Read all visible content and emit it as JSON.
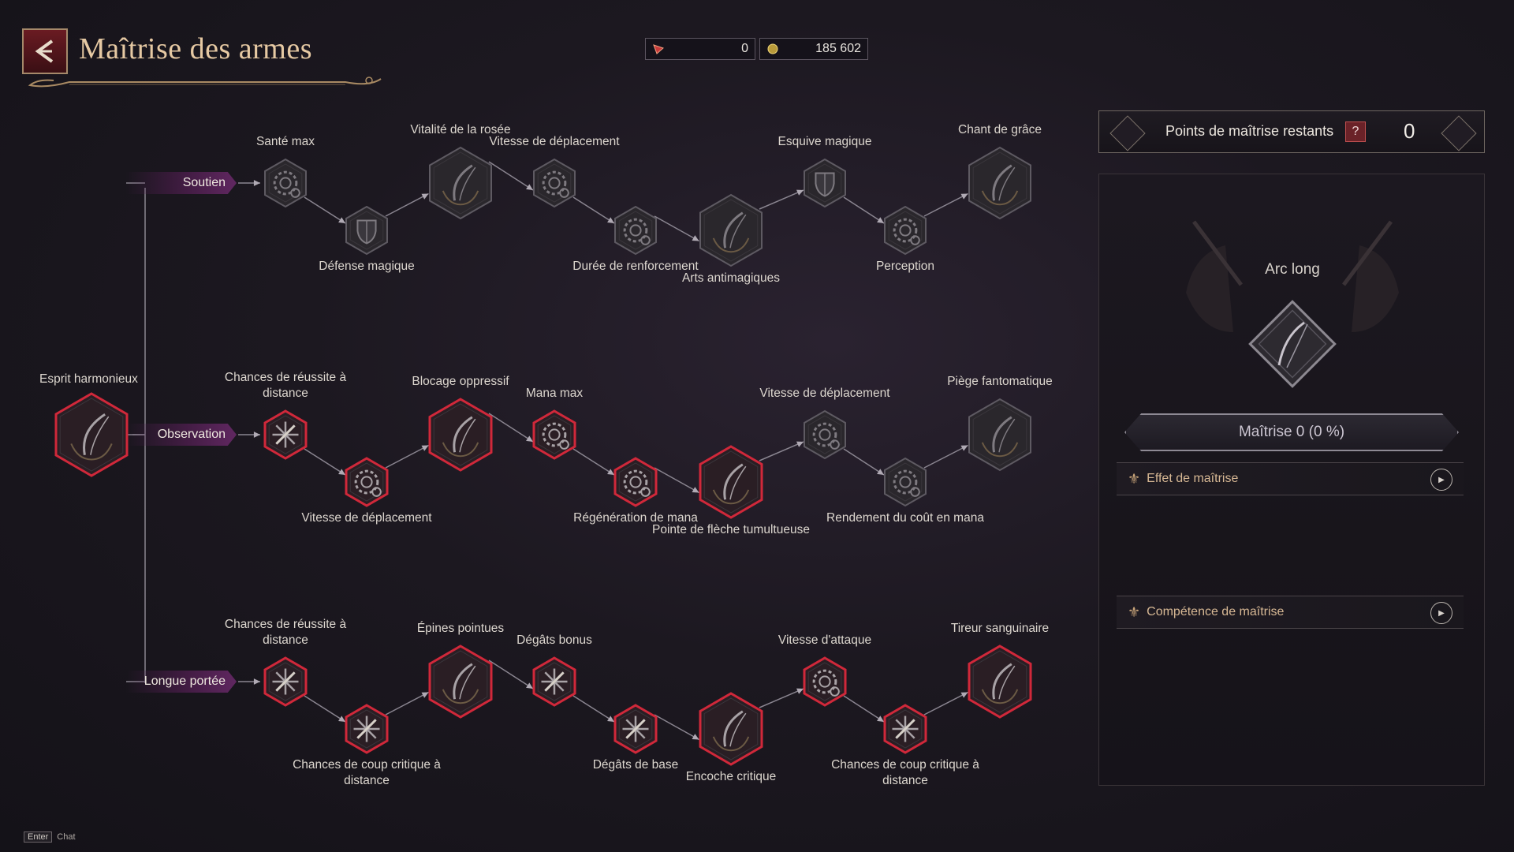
{
  "header": {
    "title": "Maîtrise des armes",
    "back_icon": "back-arrow-icon"
  },
  "currencies": [
    {
      "icon": "red-gem-icon",
      "value": "0"
    },
    {
      "icon": "gold-coin-icon",
      "value": "185 602"
    }
  ],
  "tree": {
    "origin": {
      "label": "Esprit harmonieux",
      "state": "active"
    },
    "rows": [
      {
        "label": "Soutien",
        "nodes": [
          {
            "label": "Santé max",
            "kind": "small",
            "icon": "gear-icon",
            "state": "inactive"
          },
          {
            "label": "Défense magique",
            "kind": "small",
            "icon": "shield-icon",
            "state": "inactive"
          },
          {
            "label": "Vitalité de la rosée",
            "kind": "large",
            "icon": "bow-icon",
            "state": "inactive"
          },
          {
            "label": "Vitesse de déplacement",
            "kind": "small",
            "icon": "gear-icon",
            "state": "inactive"
          },
          {
            "label": "Durée de renforcement",
            "kind": "small",
            "icon": "gear-icon",
            "state": "inactive"
          },
          {
            "label": "Arts antimagiques",
            "kind": "large",
            "icon": "bow-icon",
            "state": "inactive"
          },
          {
            "label": "Esquive magique",
            "kind": "small",
            "icon": "shield-icon",
            "state": "inactive"
          },
          {
            "label": "Perception",
            "kind": "small",
            "icon": "gear-icon",
            "state": "inactive"
          },
          {
            "label": "Chant de grâce",
            "kind": "large",
            "icon": "bow-icon",
            "state": "inactive"
          }
        ]
      },
      {
        "label": "Observation",
        "nodes": [
          {
            "label": "Chances de réussite à distance",
            "kind": "small",
            "icon": "crit-burst-icon",
            "state": "active"
          },
          {
            "label": "Vitesse de déplacement",
            "kind": "small",
            "icon": "gear-icon",
            "state": "active"
          },
          {
            "label": "Blocage oppressif",
            "kind": "large",
            "icon": "bow-icon",
            "state": "active"
          },
          {
            "label": "Mana max",
            "kind": "small",
            "icon": "gear-icon",
            "state": "active"
          },
          {
            "label": "Régénération de mana",
            "kind": "small",
            "icon": "gear-icon",
            "state": "active"
          },
          {
            "label": "Pointe de flèche tumultueuse",
            "kind": "large",
            "icon": "bow-icon",
            "state": "active"
          },
          {
            "label": "Vitesse de déplacement",
            "kind": "small",
            "icon": "gear-icon",
            "state": "inactive"
          },
          {
            "label": "Rendement du coût en mana",
            "kind": "small",
            "icon": "gear-icon",
            "state": "inactive"
          },
          {
            "label": "Piège fantomatique",
            "kind": "large",
            "icon": "bow-icon",
            "state": "inactive"
          }
        ]
      },
      {
        "label": "Longue portée",
        "nodes": [
          {
            "label": "Chances de réussite à distance",
            "kind": "small",
            "icon": "crit-burst-icon",
            "state": "active"
          },
          {
            "label": "Chances de coup critique à distance",
            "kind": "small",
            "icon": "crit-burst-icon",
            "state": "active"
          },
          {
            "label": "Épines pointues",
            "kind": "large",
            "icon": "bow-icon",
            "state": "active"
          },
          {
            "label": "Dégâts bonus",
            "kind": "small",
            "icon": "crit-burst-icon",
            "state": "active"
          },
          {
            "label": "Dégâts de base",
            "kind": "small",
            "icon": "crit-burst-icon",
            "state": "active"
          },
          {
            "label": "Encoche critique",
            "kind": "large",
            "icon": "bow-icon",
            "state": "active"
          },
          {
            "label": "Vitesse d'attaque",
            "kind": "small",
            "icon": "gear-icon",
            "state": "active"
          },
          {
            "label": "Chances de coup critique à distance",
            "kind": "small",
            "icon": "crit-burst-icon",
            "state": "active"
          },
          {
            "label": "Tireur sanguinaire",
            "kind": "large",
            "icon": "bow-icon",
            "state": "active"
          }
        ]
      }
    ]
  },
  "panel": {
    "points_label": "Points de maîtrise restants",
    "help_label": "?",
    "points_value": "0",
    "weapon_name": "Arc long",
    "mastery_text": "Maîtrise 0  (0 %)",
    "sections": [
      {
        "label": "Effet de maîtrise",
        "icon": "fleur-icon"
      },
      {
        "label": "Compétence de maîtrise",
        "icon": "fleur-icon"
      }
    ]
  },
  "chat": {
    "key": "Enter",
    "label": "Chat"
  },
  "colors": {
    "active_border": "#d0283a",
    "inactive_border": "#5e5a62",
    "accent_gold": "#e6c9a3"
  }
}
